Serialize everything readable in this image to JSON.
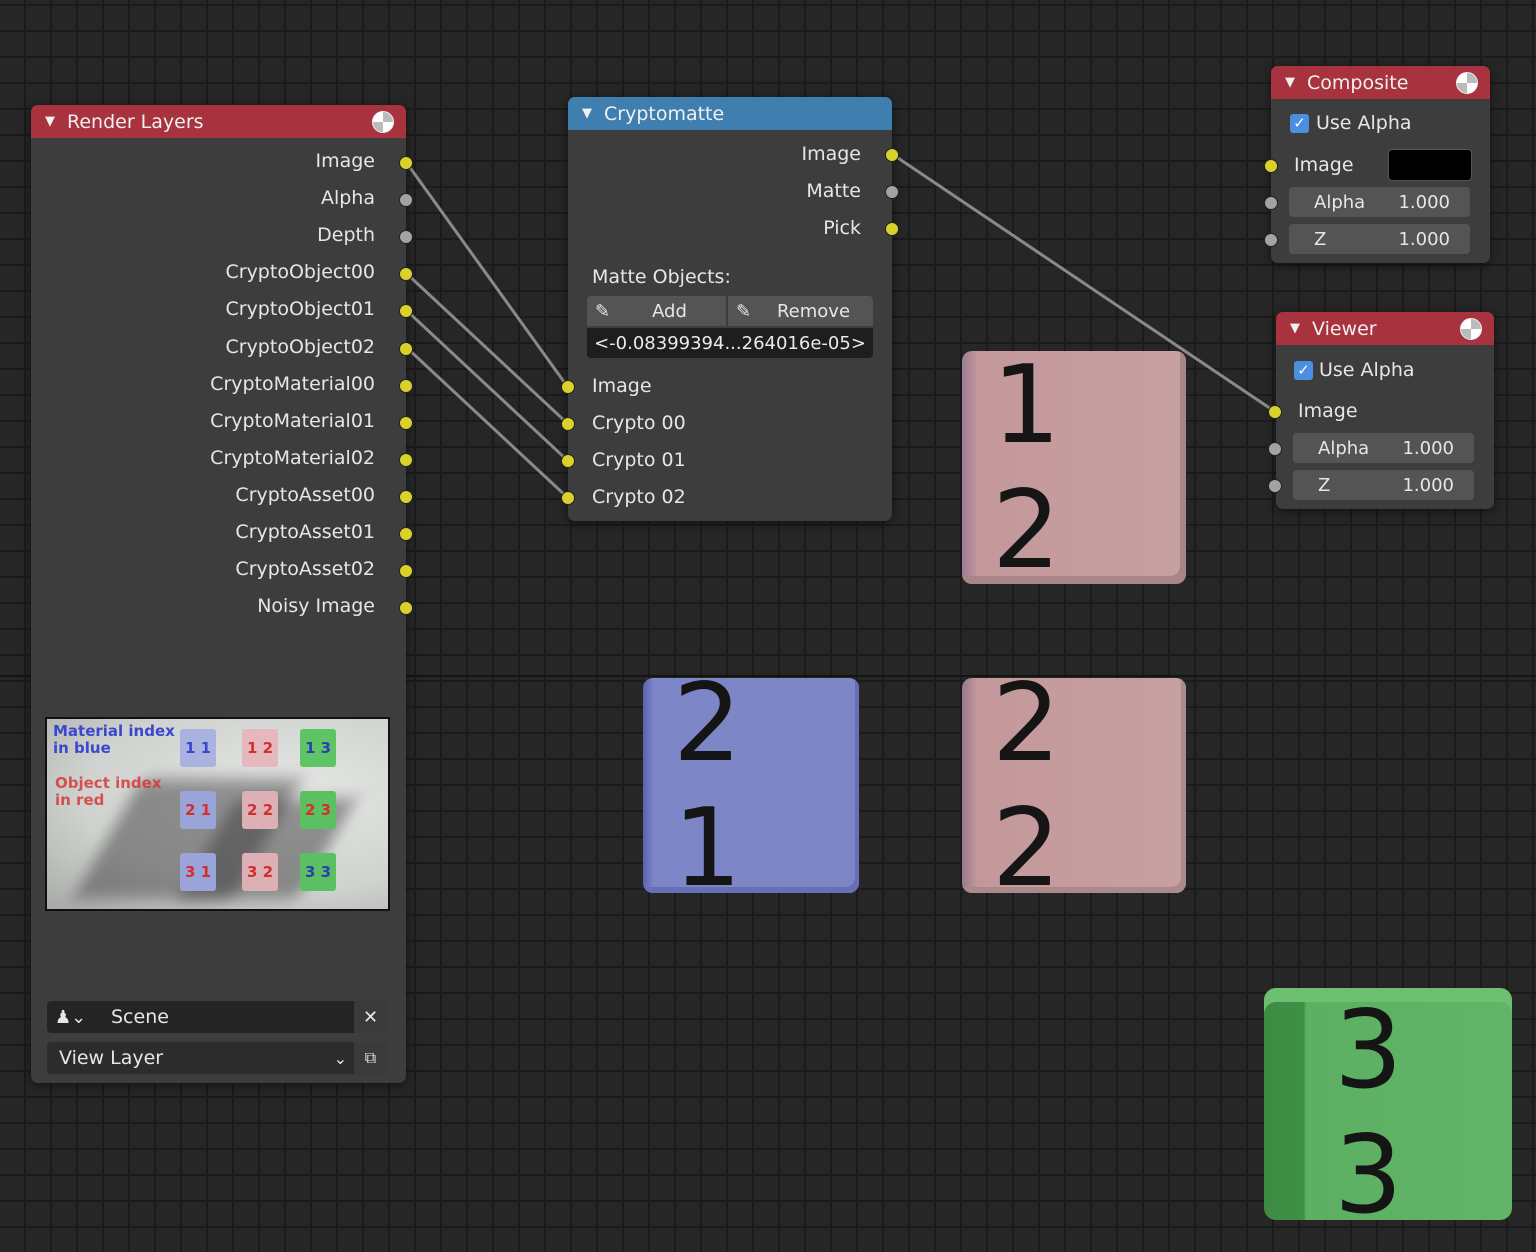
{
  "nodes": {
    "render_layers": {
      "title": "Render Layers",
      "outputs": [
        "Image",
        "Alpha",
        "Depth",
        "CryptoObject00",
        "CryptoObject01",
        "CryptoObject02",
        "CryptoMaterial00",
        "CryptoMaterial01",
        "CryptoMaterial02",
        "CryptoAsset00",
        "CryptoAsset01",
        "CryptoAsset02",
        "Noisy Image"
      ],
      "preview": {
        "material_label": "Material index\nin blue",
        "object_label": "Object index\nin red"
      },
      "scene_label": "Scene",
      "view_layer_label": "View Layer"
    },
    "cryptomatte": {
      "title": "Cryptomatte",
      "outputs": [
        "Image",
        "Matte",
        "Pick"
      ],
      "matte_objects_label": "Matte Objects:",
      "add_label": "Add",
      "remove_label": "Remove",
      "matte_value": "<-0.08399394...264016e-05>",
      "inputs": [
        "Image",
        "Crypto 00",
        "Crypto 01",
        "Crypto 02"
      ]
    },
    "composite": {
      "title": "Composite",
      "use_alpha_label": "Use Alpha",
      "use_alpha": true,
      "image_label": "Image",
      "image_color": "#000000",
      "alpha_label": "Alpha",
      "alpha_value": "1.000",
      "z_label": "Z",
      "z_value": "1.000"
    },
    "viewer": {
      "title": "Viewer",
      "use_alpha_label": "Use Alpha",
      "use_alpha": true,
      "image_label": "Image",
      "alpha_label": "Alpha",
      "alpha_value": "1.000",
      "z_label": "Z",
      "z_value": "1.000"
    }
  },
  "cubes": {
    "c12": "1 2",
    "c21": "2 1",
    "c22": "2 2",
    "c33": "3 3"
  },
  "colors": {
    "header_red": "#a8323d",
    "header_blue": "#3f7fb0",
    "socket_yellow": "#d8d22a",
    "socket_grey": "#a3a3a3",
    "cube_pink": "#c4989a",
    "cube_blue": "#7d86c6",
    "cube_green": "#5cb062"
  },
  "icons": {
    "render_node_icon": "render-icon",
    "eyedropper": "eyedropper-icon",
    "scene_icon": "scene-icon",
    "close": "close-icon",
    "copy_layer": "view-layer-icon"
  }
}
